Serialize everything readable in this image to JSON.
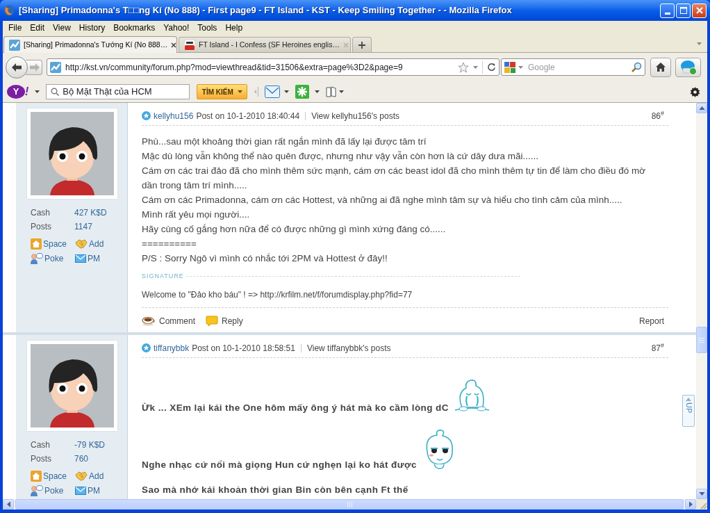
{
  "window": {
    "title": "[Sharing] Primadonna's T□□ng Kí (No 888) - First page9 - FT Island - KST - Keep Smiling Together - - Mozilla Firefox"
  },
  "menu": [
    {
      "label": "File"
    },
    {
      "label": "Edit"
    },
    {
      "label": "View"
    },
    {
      "label": "History"
    },
    {
      "label": "Bookmarks"
    },
    {
      "label": "Yahoo!"
    },
    {
      "label": "Tools"
    },
    {
      "label": "Help"
    }
  ],
  "tabs": [
    {
      "title": "[Sharing] Primadonna's Tướng Kí (No 888…",
      "kind": "forum",
      "selected": true
    },
    {
      "title": "FT Island - I Confess (SF Heroines englis…",
      "kind": "video",
      "selected": false
    }
  ],
  "nav": {
    "forward": {
      "disabled": true
    },
    "url": "http://kst.vn/community/forum.php?mod=viewthread&tid=31506&extra=page%3D2&page=9",
    "search": {
      "placeholder": "Google"
    }
  },
  "yahoo_toolbar": {
    "logo_letter": "Y",
    "logo_mark": "!",
    "search_value": "Bộ Mặt Thật của HCM",
    "search_button": "TÌM KIẾM"
  },
  "posts": [
    {
      "author": "kellyhu156",
      "posted": "Post on 10-1-2010 18:40:44",
      "view_link": "View kellyhu156's posts",
      "floor": "86$^{#}$",
      "profile": {
        "stats": [
          {
            "label": "Cash",
            "value": "427 K$D"
          },
          {
            "label": "Posts",
            "value": "1147"
          }
        ],
        "links": [
          {
            "label": "Space",
            "kind": "home"
          },
          {
            "label": "Add",
            "kind": "friend"
          },
          {
            "label": "Poke",
            "kind": "poke"
          },
          {
            "label": "PM",
            "kind": "message"
          }
        ]
      },
      "body": {
        "kind": "plain",
        "lines": [
          {
            "text": "Phù...sau một khoảng thời gian rất ngắn mình đã lấy lại được tâm trí"
          },
          {
            "text": "Mặc dù lòng vẫn không thể nào quên được, nhưng như vậy vẫn còn hơn là cứ dây dưa mãi......"
          },
          {
            "text": "Cám ơn các trai đảo đã cho mình thêm sức mạnh, cám ơn các beast idol đã cho mình thêm tự tin để làm cho điều đó mờ dần trong tâm trí mình....."
          },
          {
            "text": "Cám ơn các Primadonna, cám ơn các Hottest, và những ai đã nghe mình tâm sự và hiểu cho tình cảm của mình....."
          },
          {
            "text": "Mình rất yêu mọi người...."
          },
          {
            "text": "Hãy cùng cố gắng hơn nữa để có được những gì mình xứng đáng có......"
          },
          {
            "text": "=========="
          },
          {
            "text": "P/S :  Sorry Ngô vì mình có nhắc tới 2PM và Hottest ở đây!!"
          }
        ]
      },
      "signature": {
        "label": "SIGNATURE",
        "text": "Welcome to \"Đảo kho báu\" ! => http://krfilm.net/f/forumdisplay.php?fid=77"
      },
      "actions": [
        {
          "label": "Comment",
          "kind": "comment"
        },
        {
          "label": "Reply",
          "kind": "reply"
        }
      ],
      "report": "Report"
    },
    {
      "author": "tiffanybbk",
      "posted": "Post on 10-1-2010 18:58:51",
      "view_link": "View tiffanybbk's posts",
      "floor": "87$^{#}$",
      "profile": {
        "stats": [
          {
            "label": "Cash",
            "value": "-79 K$D"
          },
          {
            "label": "Posts",
            "value": "760"
          }
        ],
        "links": [
          {
            "label": "Space",
            "kind": "home"
          },
          {
            "label": "Add",
            "kind": "friend"
          },
          {
            "label": "Poke",
            "kind": "poke"
          },
          {
            "label": "PM",
            "kind": "message"
          }
        ]
      },
      "body": {
        "kind": "bold",
        "lines": [
          {
            "text": "Ừk ... XEm lại kái the One hôm mấy ông ý hát mà ko cầm lòng dC",
            "emoticon": {
              "kind": "crying"
            }
          },
          {
            "text": "Nghe nhạc cứ nổi mà giọng Hun cứ nghẹn lại ko hát được",
            "emoticon": {
              "kind": "sleepy"
            }
          },
          {
            "text": "Sao mà nhớ kái khoản thời gian Bin còn bên cạnh Ft thế"
          }
        ]
      }
    }
  ],
  "back_to_top": {
    "label": "UP"
  }
}
